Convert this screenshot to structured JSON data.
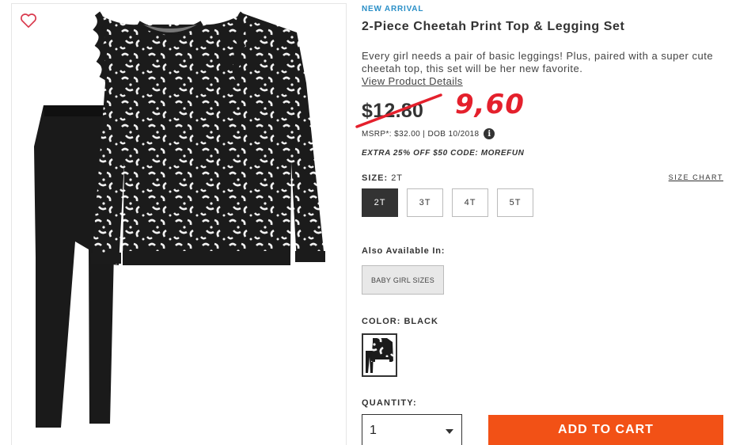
{
  "product": {
    "badge": "NEW ARRIVAL",
    "title": "2-Piece Cheetah Print Top & Legging Set",
    "description": "Every girl needs a pair of basic leggings! Plus, paired with a super cute cheetah top, this set will be her new favorite.",
    "view_details": "View Product Details"
  },
  "pricing": {
    "price": "$12.80",
    "handwritten_price": "9,60",
    "msrp": "MSRP*: $32.00 | DOB 10/2018",
    "promo": "EXTRA 25% OFF $50 CODE: MOREFUN"
  },
  "size": {
    "label": "SIZE:",
    "selected": "2T",
    "chart_link": "SIZE CHART",
    "options": [
      "2T",
      "3T",
      "4T",
      "5T"
    ]
  },
  "also_available": {
    "label": "Also Available In:",
    "button": "BABY GIRL SIZES"
  },
  "color": {
    "label": "COLOR:",
    "selected": "BLACK"
  },
  "quantity": {
    "label": "QUANTITY:",
    "value": "1"
  },
  "cart": {
    "button": "ADD TO CART"
  },
  "colors": {
    "accent_blue": "#2a8fc7",
    "cta_orange": "#f25116",
    "handwritten_red": "#e4202c",
    "heart": "#d9374b"
  },
  "icons": {
    "wishlist": "heart-outline-icon",
    "info": "info-icon",
    "dropdown": "caret-down-icon"
  }
}
